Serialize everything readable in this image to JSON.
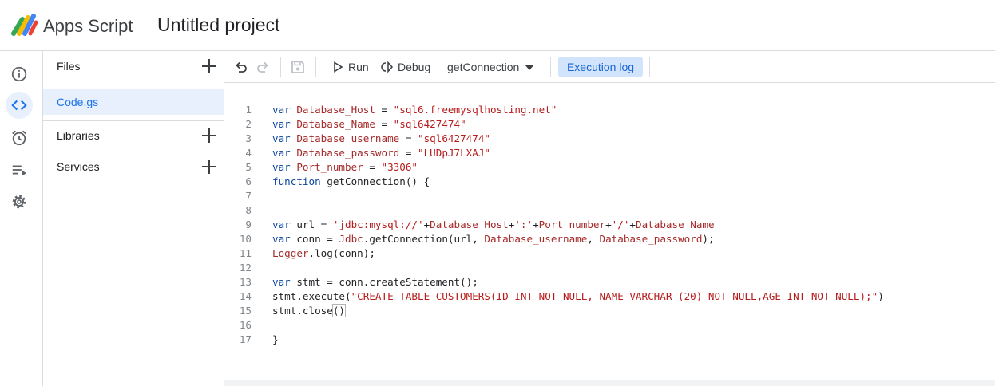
{
  "header": {
    "app_name": "Apps Script",
    "project_title": "Untitled project"
  },
  "rail": {
    "items": [
      {
        "icon": "info-icon"
      },
      {
        "icon": "code-icon",
        "active": true
      },
      {
        "icon": "alarm-clock-icon"
      },
      {
        "icon": "playlist-play-icon"
      },
      {
        "icon": "gear-icon"
      }
    ]
  },
  "panel": {
    "files_label": "Files",
    "files": [
      "Code.gs"
    ],
    "libraries_label": "Libraries",
    "services_label": "Services"
  },
  "toolbar": {
    "run_label": "Run",
    "debug_label": "Debug",
    "function_select": "getConnection",
    "execution_log_label": "Execution log"
  },
  "colors": {
    "accent": "#1a73e8",
    "active_bg": "#e8f0fe",
    "exec_log_bg": "#d2e3fc",
    "keyword": "#0d47a1",
    "variable": "#a52a2a",
    "string": "#b71c1c",
    "line_number": "#80868b"
  },
  "editor": {
    "lines": [
      [
        {
          "t": "var",
          "c": "kw"
        },
        {
          "t": " "
        },
        {
          "t": "Database_Host",
          "c": "var"
        },
        {
          "t": " = "
        },
        {
          "t": "\"sql6.freemysqlhosting.net\"",
          "c": "str"
        }
      ],
      [
        {
          "t": "var",
          "c": "kw"
        },
        {
          "t": " "
        },
        {
          "t": "Database_Name",
          "c": "var"
        },
        {
          "t": " = "
        },
        {
          "t": "\"sql6427474\"",
          "c": "str"
        }
      ],
      [
        {
          "t": "var",
          "c": "kw"
        },
        {
          "t": " "
        },
        {
          "t": "Database_username",
          "c": "var"
        },
        {
          "t": " = "
        },
        {
          "t": "\"sql6427474\"",
          "c": "str"
        }
      ],
      [
        {
          "t": "var",
          "c": "kw"
        },
        {
          "t": " "
        },
        {
          "t": "Database_password",
          "c": "var"
        },
        {
          "t": " = "
        },
        {
          "t": "\"LUDpJ7LXAJ\"",
          "c": "str"
        }
      ],
      [
        {
          "t": "var",
          "c": "kw"
        },
        {
          "t": " "
        },
        {
          "t": "Port_number",
          "c": "var"
        },
        {
          "t": " = "
        },
        {
          "t": "\"3306\"",
          "c": "str"
        }
      ],
      [
        {
          "t": "function",
          "c": "kw"
        },
        {
          "t": " getConnection() {"
        }
      ],
      [],
      [],
      [
        {
          "t": "var",
          "c": "kw"
        },
        {
          "t": " url = "
        },
        {
          "t": "'jdbc:mysql://'",
          "c": "str"
        },
        {
          "t": "+"
        },
        {
          "t": "Database_Host",
          "c": "var"
        },
        {
          "t": "+"
        },
        {
          "t": "':'",
          "c": "str"
        },
        {
          "t": "+"
        },
        {
          "t": "Port_number",
          "c": "var"
        },
        {
          "t": "+"
        },
        {
          "t": "'/'",
          "c": "str"
        },
        {
          "t": "+"
        },
        {
          "t": "Database_Name",
          "c": "var"
        }
      ],
      [
        {
          "t": "var",
          "c": "kw"
        },
        {
          "t": " conn = "
        },
        {
          "t": "Jdbc",
          "c": "var"
        },
        {
          "t": ".getConnection(url, "
        },
        {
          "t": "Database_username",
          "c": "var"
        },
        {
          "t": ", "
        },
        {
          "t": "Database_password",
          "c": "var"
        },
        {
          "t": ");"
        }
      ],
      [
        {
          "t": "Logger",
          "c": "var"
        },
        {
          "t": ".log(conn);"
        }
      ],
      [],
      [
        {
          "t": "var",
          "c": "kw"
        },
        {
          "t": " stmt = conn.createStatement();"
        }
      ],
      [
        {
          "t": "stmt.execute("
        },
        {
          "t": "\"CREATE TABLE CUSTOMERS(ID INT NOT NULL, NAME VARCHAR (20) NOT NULL,AGE INT NOT NULL);\"",
          "c": "str"
        },
        {
          "t": ")"
        }
      ],
      [
        {
          "t": "stmt.close"
        },
        {
          "t": "()",
          "c": "bracket-hl"
        }
      ],
      [],
      [
        {
          "t": "}"
        }
      ]
    ]
  }
}
